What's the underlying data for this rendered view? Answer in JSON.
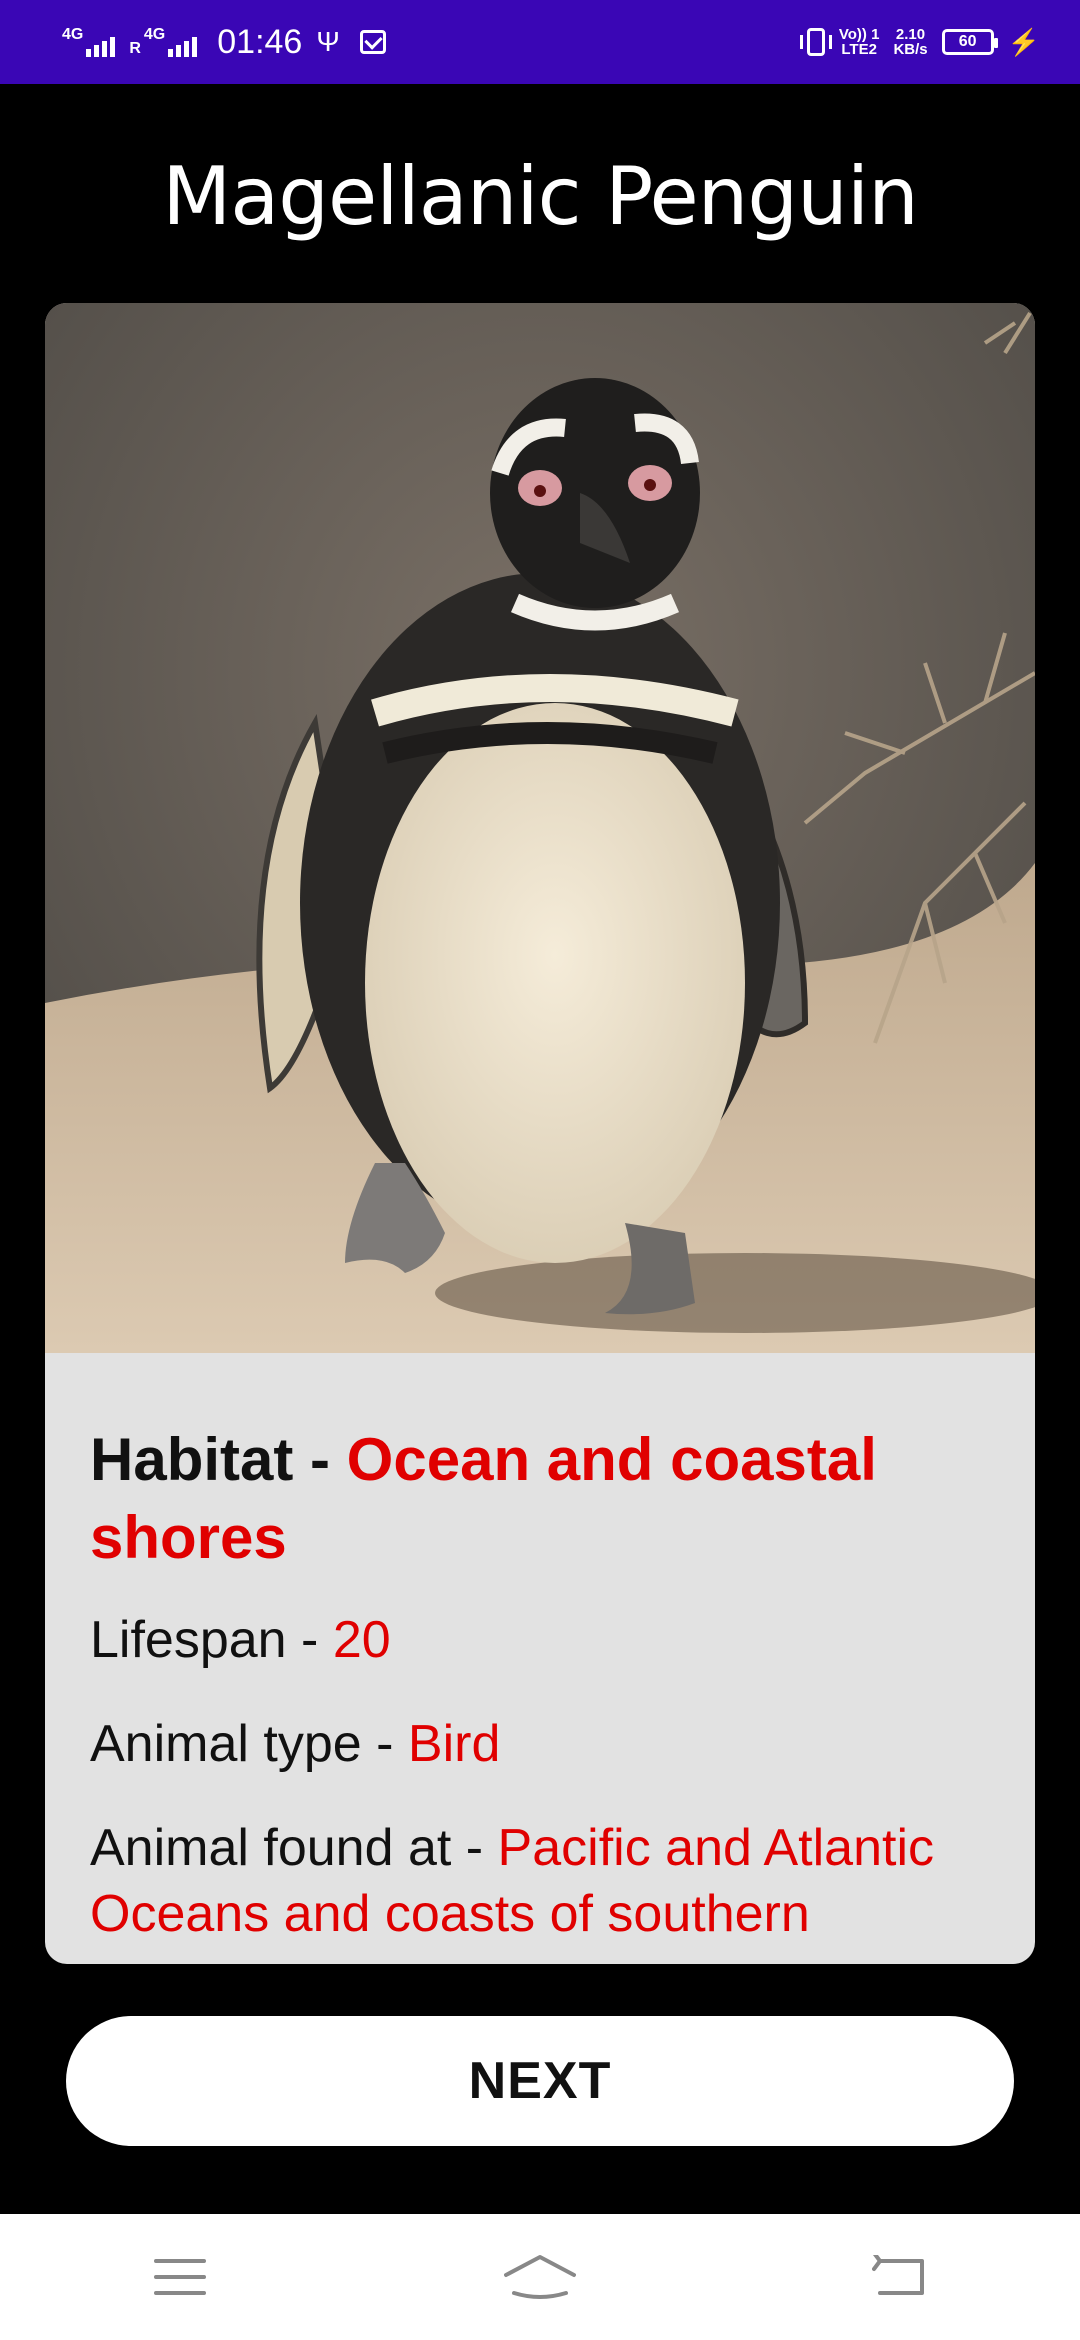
{
  "status_bar": {
    "sim1_label": "4G",
    "sim2_label": "4G",
    "roaming": "R",
    "time": "01:46",
    "volte_label": "Vo)) 1",
    "lte_label": "LTE2",
    "speed_value": "2.10",
    "speed_unit": "KB/s",
    "battery": "60"
  },
  "header": {
    "title": "Magellanic Penguin"
  },
  "card": {
    "image_alt": "penguin-photo",
    "habitat_label": "Habitat - ",
    "habitat_value": "Ocean and coastal shores",
    "lifespan_label": "Lifespan - ",
    "lifespan_value": "20",
    "type_label": "Animal type - ",
    "type_value": "Bird",
    "found_label": "Animal found at - ",
    "found_value": "Pacific and Atlantic Oceans and coasts of southern"
  },
  "actions": {
    "next_label": "NEXT"
  },
  "nav": {
    "menu_icon": "menu-icon",
    "home_icon": "home-icon",
    "back_icon": "back-icon"
  },
  "colors": {
    "status_bar": "#3a06b5",
    "accent_red": "#e00000",
    "card_bg": "#e2e2e2"
  }
}
